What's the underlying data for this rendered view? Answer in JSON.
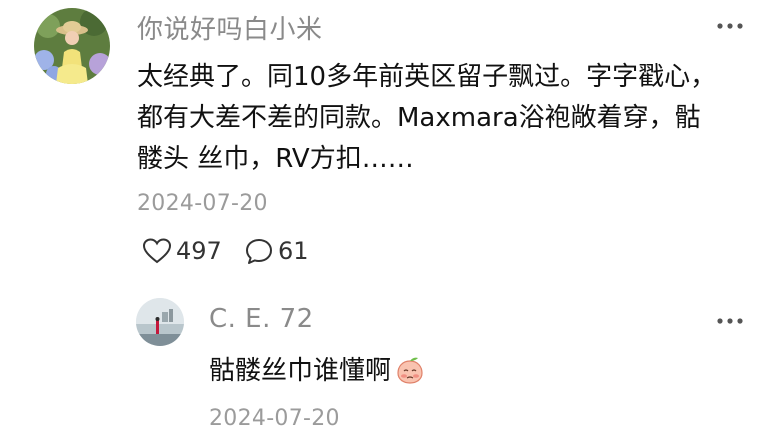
{
  "main_comment": {
    "username": "你说好吗白小米",
    "content": "太经典了。同10多年前英区留子飘过。字字戳心，都有大差不差的同款。Maxmara浴袍敞着穿，骷髅头 丝巾，RV方扣……",
    "date": "2024-07-20",
    "likes": "497",
    "replies": "61",
    "like_icon": "heart-outline-icon",
    "reply_icon": "speech-bubble-icon"
  },
  "reply": {
    "username": "C. E. 72",
    "content": "骷髅丝巾谁懂啊",
    "emoji": "peach-face-emoji",
    "date": "2024-07-20"
  }
}
